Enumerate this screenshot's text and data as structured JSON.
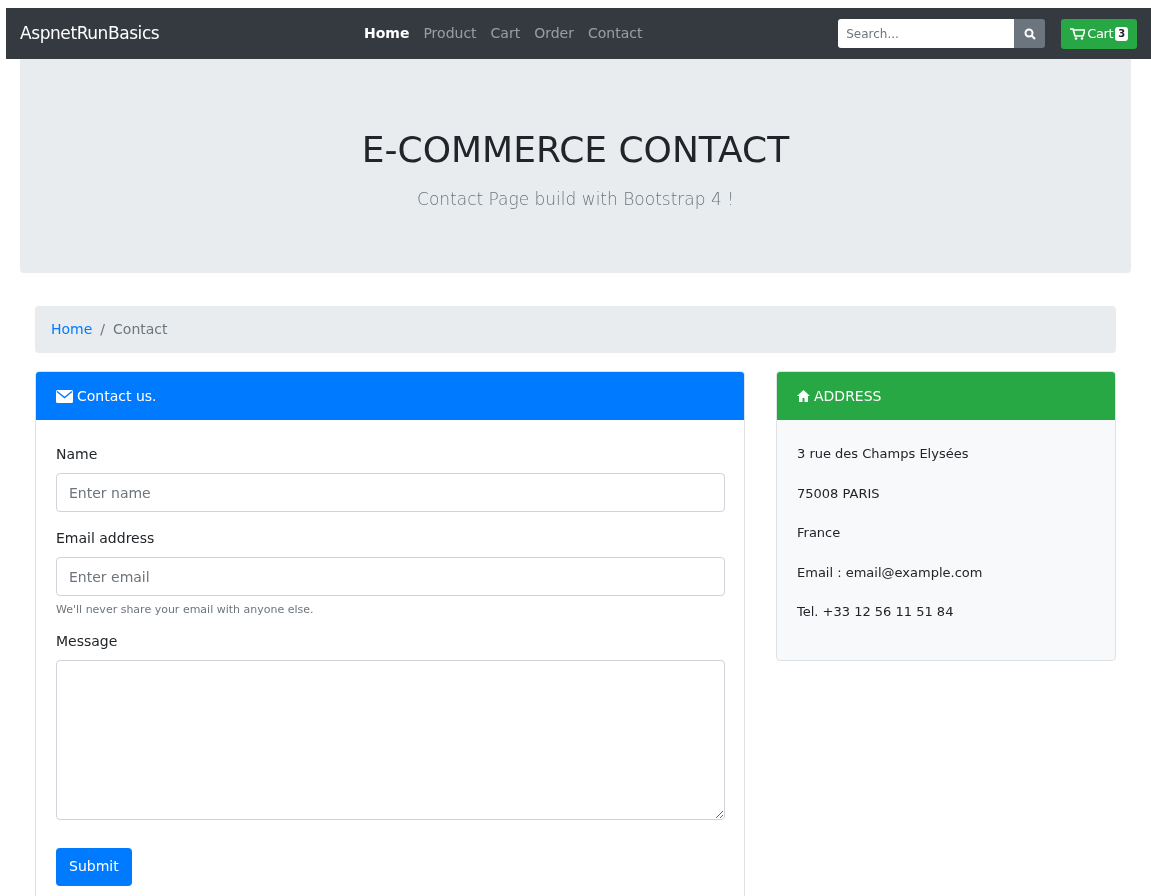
{
  "navbar": {
    "brand": "AspnetRunBasics",
    "links": [
      {
        "label": "Home",
        "selected": true
      },
      {
        "label": "Product",
        "selected": false
      },
      {
        "label": "Cart",
        "selected": false
      },
      {
        "label": "Order",
        "selected": false
      },
      {
        "label": "Contact",
        "selected": false
      }
    ],
    "search": {
      "placeholder": "Search..."
    },
    "cart": {
      "label": "Cart",
      "count": "3"
    }
  },
  "hero": {
    "title": "E-COMMERCE CONTACT",
    "subtitle": "Contact Page build with Bootstrap 4 !"
  },
  "breadcrumb_separator": "/",
  "breadcrumb": [
    {
      "label": "Home",
      "kind": "link"
    },
    {
      "label": "Contact",
      "kind": "current"
    }
  ],
  "contact_form": {
    "title": "Contact us.",
    "fields": [
      {
        "label": "Name",
        "placeholder": "Enter name",
        "kind": "input"
      },
      {
        "label": "Email address",
        "placeholder": "Enter email",
        "kind": "input",
        "help": "We'll never share your email with anyone else."
      },
      {
        "label": "Message",
        "kind": "textarea"
      }
    ],
    "submit": "Submit"
  },
  "address": {
    "title": "ADDRESS",
    "lines": [
      "3 rue des Champs Elysées",
      "75008 PARIS",
      "France",
      "Email : email@example.com",
      "Tel. +33 12 56 11 51 84"
    ]
  }
}
